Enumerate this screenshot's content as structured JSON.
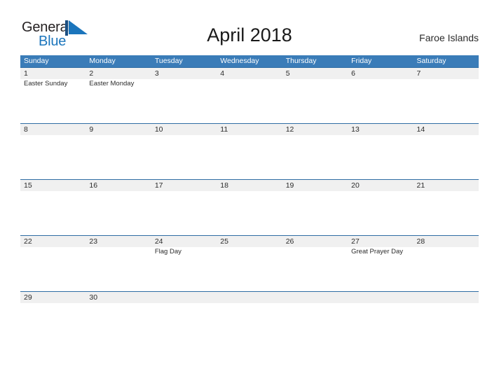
{
  "logo": {
    "text_primary": "General",
    "text_secondary": "Blue",
    "flag_icon": "blue-flag-triangle-icon",
    "flag_color": "#1b75bc"
  },
  "header": {
    "title": "April 2018",
    "location": "Faroe Islands"
  },
  "colors": {
    "header_blue": "#3a7cb8",
    "row_separator_blue": "#2e6da4",
    "date_band_gray": "#f0f0f0",
    "logo_blue": "#1b75bc",
    "text_dark": "#2b2b2b"
  },
  "calendar": {
    "month": "April",
    "year": "2018",
    "weekdays": [
      "Sunday",
      "Monday",
      "Tuesday",
      "Wednesday",
      "Thursday",
      "Friday",
      "Saturday"
    ],
    "weeks": [
      [
        {
          "day": "1",
          "event": "Easter Sunday"
        },
        {
          "day": "2",
          "event": "Easter Monday"
        },
        {
          "day": "3",
          "event": ""
        },
        {
          "day": "4",
          "event": ""
        },
        {
          "day": "5",
          "event": ""
        },
        {
          "day": "6",
          "event": ""
        },
        {
          "day": "7",
          "event": ""
        }
      ],
      [
        {
          "day": "8",
          "event": ""
        },
        {
          "day": "9",
          "event": ""
        },
        {
          "day": "10",
          "event": ""
        },
        {
          "day": "11",
          "event": ""
        },
        {
          "day": "12",
          "event": ""
        },
        {
          "day": "13",
          "event": ""
        },
        {
          "day": "14",
          "event": ""
        }
      ],
      [
        {
          "day": "15",
          "event": ""
        },
        {
          "day": "16",
          "event": ""
        },
        {
          "day": "17",
          "event": ""
        },
        {
          "day": "18",
          "event": ""
        },
        {
          "day": "19",
          "event": ""
        },
        {
          "day": "20",
          "event": ""
        },
        {
          "day": "21",
          "event": ""
        }
      ],
      [
        {
          "day": "22",
          "event": ""
        },
        {
          "day": "23",
          "event": ""
        },
        {
          "day": "24",
          "event": "Flag Day"
        },
        {
          "day": "25",
          "event": ""
        },
        {
          "day": "26",
          "event": ""
        },
        {
          "day": "27",
          "event": "Great Prayer Day"
        },
        {
          "day": "28",
          "event": ""
        }
      ],
      [
        {
          "day": "29",
          "event": ""
        },
        {
          "day": "30",
          "event": ""
        },
        {
          "day": "",
          "event": ""
        },
        {
          "day": "",
          "event": ""
        },
        {
          "day": "",
          "event": ""
        },
        {
          "day": "",
          "event": ""
        },
        {
          "day": "",
          "event": ""
        }
      ]
    ]
  }
}
